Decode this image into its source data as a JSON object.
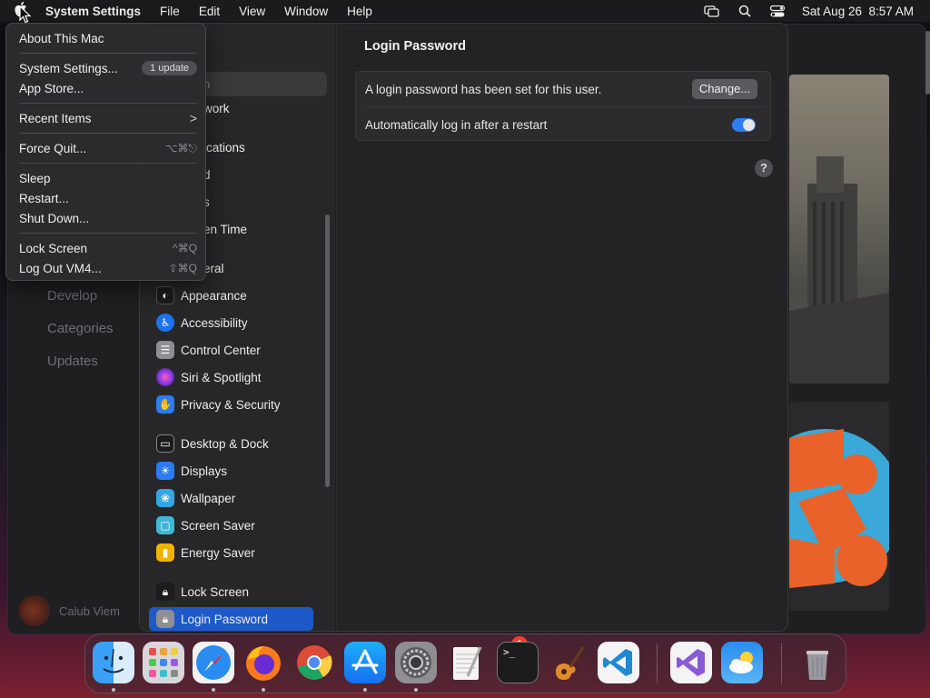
{
  "menubar": {
    "app_name": "System Settings",
    "menus": [
      "File",
      "Edit",
      "View",
      "Window",
      "Help"
    ],
    "datetime": "Sat Aug 26  8:57 AM"
  },
  "apple_menu": {
    "about": "About This Mac",
    "system_settings": "System Settings...",
    "update_badge": "1 update",
    "app_store": "App Store...",
    "recent_items": "Recent Items",
    "recent_items_chevron": ">",
    "force_quit": "Force Quit...",
    "force_quit_shortcut": "⌥⌘⎋",
    "sleep": "Sleep",
    "restart": "Restart...",
    "shut_down": "Shut Down...",
    "lock_screen": "Lock Screen",
    "lock_screen_shortcut": "^⌘Q",
    "log_out": "Log Out VM4...",
    "log_out_shortcut": "⇧⌘Q"
  },
  "back_window": {
    "sidebar": [
      "Develop",
      "Categories",
      "Updates"
    ],
    "user_name": "Calub Viem"
  },
  "settings": {
    "search_placeholder": "h",
    "partial_items": [
      "work",
      "ications",
      "d",
      "s",
      "en Time",
      "eral"
    ],
    "sidebar_items": [
      {
        "label": "Appearance",
        "icon": "appearance-icon",
        "color": "#1c1c1e"
      },
      {
        "label": "Accessibility",
        "icon": "accessibility-icon",
        "color": "#1a73e8"
      },
      {
        "label": "Control Center",
        "icon": "control-center-icon",
        "color": "#8e8e93"
      },
      {
        "label": "Siri & Spotlight",
        "icon": "siri-icon",
        "color": "#c03ad6"
      },
      {
        "label": "Privacy & Security",
        "icon": "privacy-hand-icon",
        "color": "#2d7bf0"
      },
      {
        "label": "Desktop & Dock",
        "icon": "desktop-dock-icon",
        "color": "#1c1c1e"
      },
      {
        "label": "Displays",
        "icon": "displays-icon",
        "color": "#2d7bf0"
      },
      {
        "label": "Wallpaper",
        "icon": "wallpaper-icon",
        "color": "#31a8e0"
      },
      {
        "label": "Screen Saver",
        "icon": "screen-saver-icon",
        "color": "#40b8d8"
      },
      {
        "label": "Energy Saver",
        "icon": "energy-saver-icon",
        "color": "#f2b200"
      },
      {
        "label": "Lock Screen",
        "icon": "lock-icon",
        "color": "#1c1c1e"
      },
      {
        "label": "Login Password",
        "icon": "login-password-icon",
        "color": "#8e8e93"
      }
    ],
    "content": {
      "title": "Login Password",
      "password_set_text": "A login password has been set for this user.",
      "change_button": "Change...",
      "auto_login_text": "Automatically log in after a restart",
      "auto_login_enabled": true,
      "help": "?"
    }
  },
  "dock": {
    "apps": [
      "Finder",
      "Launchpad",
      "Safari",
      "Firefox",
      "Chrome",
      "App Store",
      "System Settings",
      "TextEdit",
      "Terminal",
      "GarageBand",
      "Visual Studio Code",
      "Visual Studio",
      "Weather",
      "Trash"
    ],
    "settings_badge": "1",
    "terminal_prompt": ">_"
  },
  "colors": {
    "accent": "#2c7ef6",
    "selection": "#1d59c9",
    "badge_red": "#ff3b30"
  }
}
